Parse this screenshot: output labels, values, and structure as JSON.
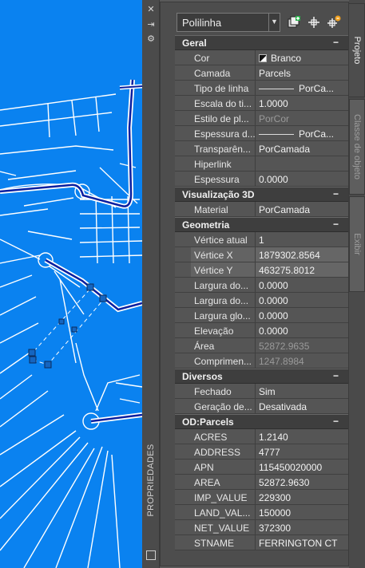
{
  "palette": {
    "title": "PROPRIEDADES",
    "close_glyph": "✕",
    "autohide_glyph": "⇥",
    "props_glyph": "⚙"
  },
  "toolbar": {
    "object_type": "Polilinha",
    "icons": [
      "quick-select-icon",
      "select-objects-icon",
      "toggle-pickadd-icon"
    ]
  },
  "tabs": [
    {
      "label": "Projeto",
      "selected": true
    },
    {
      "label": "Classe de objeto",
      "selected": false
    },
    {
      "label": "Exibir",
      "selected": false
    }
  ],
  "sections": {
    "geral": {
      "title": "Geral",
      "collapse": "−",
      "rows": [
        {
          "key": "Cor",
          "value": "Branco"
        },
        {
          "key": "Camada",
          "value": "Parcels"
        },
        {
          "key": "Tipo de linha",
          "value": "PorCa..."
        },
        {
          "key": "Escala do ti...",
          "value": "1.0000"
        },
        {
          "key": "Estilo de pl...",
          "value": "PorCor"
        },
        {
          "key": "Espessura d...",
          "value": "PorCa..."
        },
        {
          "key": "Transparên...",
          "value": "PorCamada"
        },
        {
          "key": "Hiperlink",
          "value": ""
        },
        {
          "key": "Espessura",
          "value": "0.0000"
        }
      ]
    },
    "vis3d": {
      "title": "Visualização 3D",
      "collapse": "−",
      "rows": [
        {
          "key": "Material",
          "value": "PorCamada"
        }
      ]
    },
    "geometria": {
      "title": "Geometria",
      "collapse": "−",
      "rows": [
        {
          "key": "Vértice atual",
          "value": "1"
        },
        {
          "key": "Vértice X",
          "value": "1879302.8564"
        },
        {
          "key": "Vértice Y",
          "value": "463275.8012"
        },
        {
          "key": "Largura do...",
          "value": "0.0000"
        },
        {
          "key": "Largura do...",
          "value": "0.0000"
        },
        {
          "key": "Largura glo...",
          "value": "0.0000"
        },
        {
          "key": "Elevação",
          "value": "0.0000"
        },
        {
          "key": "Área",
          "value": "52872.9635"
        },
        {
          "key": "Comprimen...",
          "value": "1247.8984"
        }
      ]
    },
    "diversos": {
      "title": "Diversos",
      "collapse": "−",
      "rows": [
        {
          "key": "Fechado",
          "value": "Sim"
        },
        {
          "key": "Geração de...",
          "value": "Desativada"
        }
      ]
    },
    "odparcels": {
      "title": "OD:Parcels",
      "collapse": "−",
      "rows": [
        {
          "key": "ACRES",
          "value": "1.2140"
        },
        {
          "key": "ADDRESS",
          "value": "4777"
        },
        {
          "key": "APN",
          "value": "115450020000"
        },
        {
          "key": "AREA",
          "value": "52872.9630"
        },
        {
          "key": "IMP_VALUE",
          "value": "229300"
        },
        {
          "key": "LAND_VAL...",
          "value": "150000"
        },
        {
          "key": "NET_VALUE",
          "value": "372300"
        },
        {
          "key": "STNAME",
          "value": "FERRINGTON CT"
        }
      ]
    }
  },
  "colors": {
    "drawing_background": "#0a82f0",
    "parcel_lines": "#ffffff",
    "road_centerline": "#0a1fa0",
    "grip": "#1565c0"
  }
}
